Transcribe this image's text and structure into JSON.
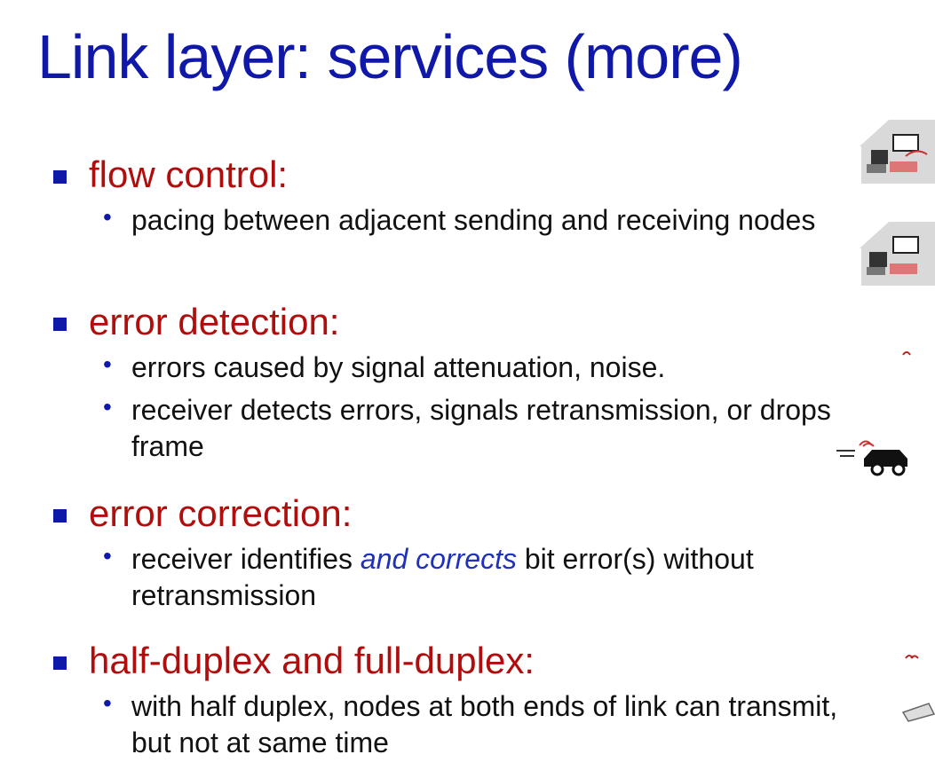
{
  "slide": {
    "title": "Link layer: services (more)",
    "sections": [
      {
        "heading": "flow control:",
        "bullets": [
          "pacing between adjacent sending and receiving nodes"
        ]
      },
      {
        "heading": "error detection:",
        "bullets": [
          "errors caused by signal attenuation, noise.",
          "receiver detects errors, signals retransmission, or drops frame"
        ]
      },
      {
        "heading": "error correction:",
        "bullets": [
          {
            "before": "receiver identifies ",
            "emphasis": "and corrects",
            "after": " bit error(s) without retransmission"
          }
        ]
      },
      {
        "heading": "half-duplex and full-duplex:",
        "bullets": [
          "with half duplex, nodes at both ends of link can transmit, but not at same time"
        ]
      }
    ]
  },
  "decor": {
    "icons": [
      "home-network-icon",
      "home-network-icon",
      "wireless-signal-icon",
      "vehicle-wireless-icon",
      "wireless-signal-icon",
      "router-icon"
    ],
    "colors": {
      "title": "#0f18a8",
      "heading": "#b00d0d",
      "emphasis": "#1f31b8"
    }
  }
}
